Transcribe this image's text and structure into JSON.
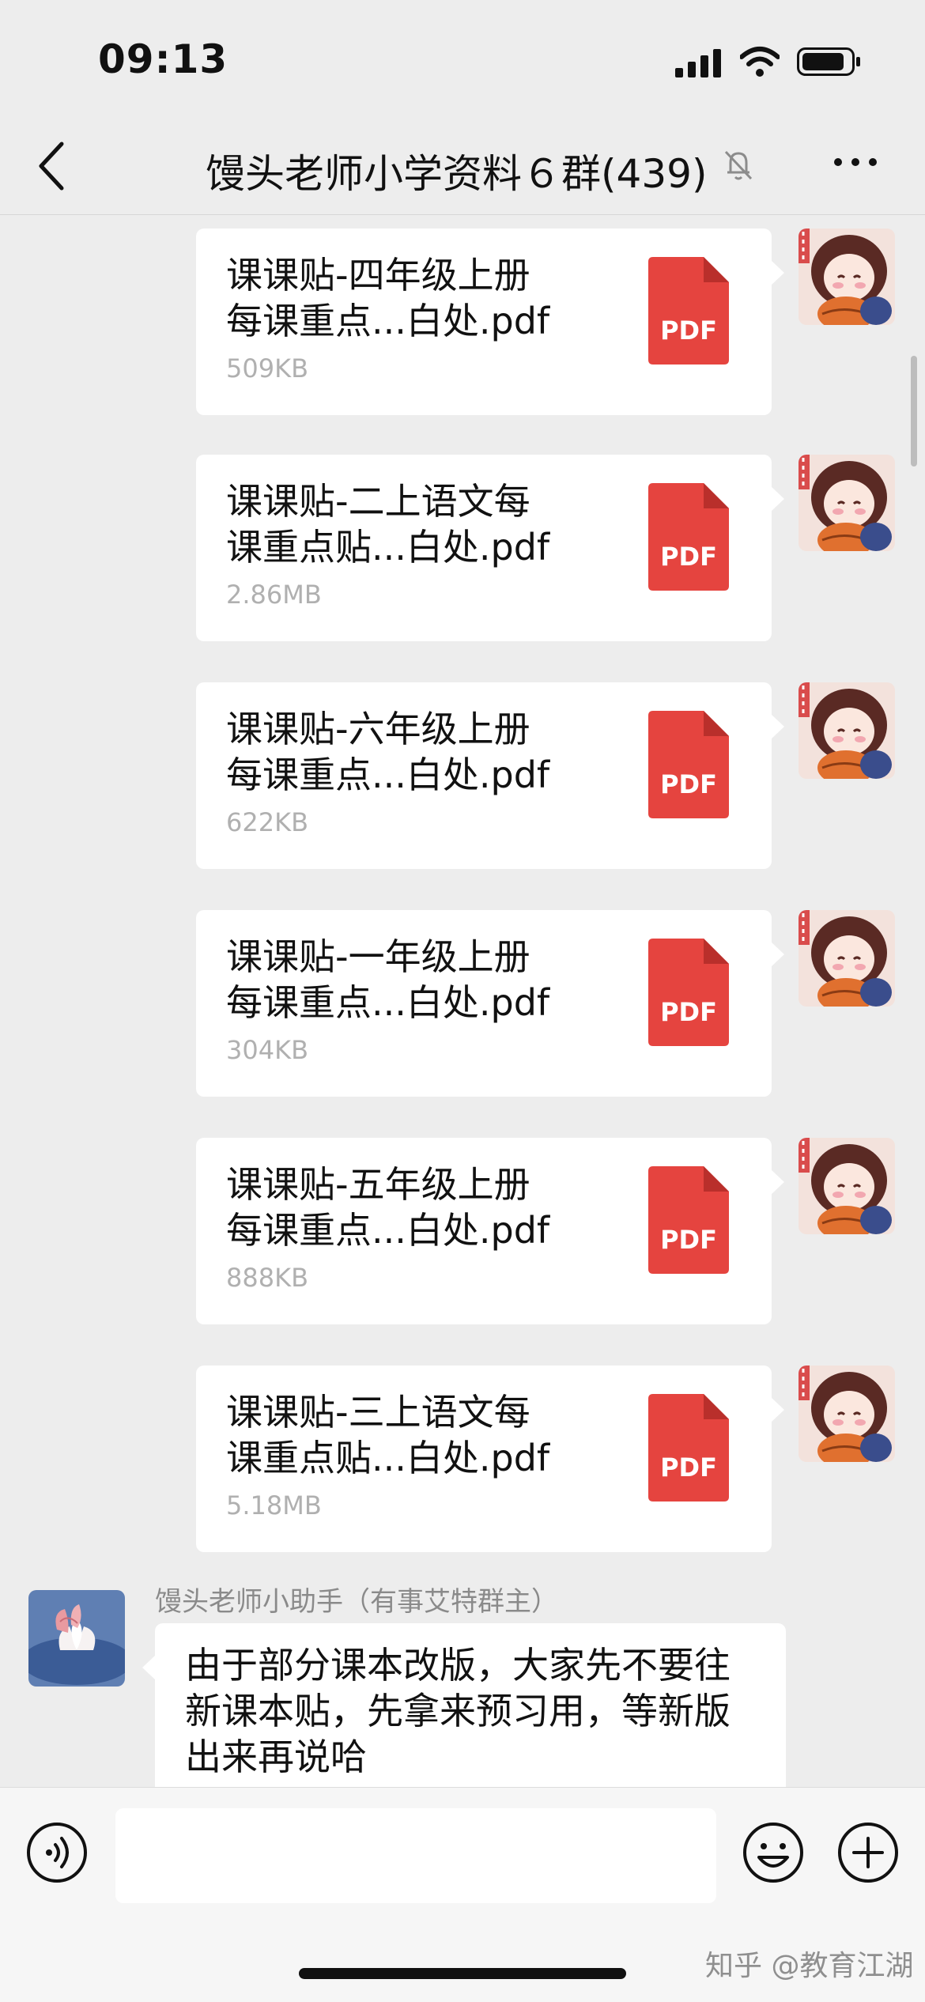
{
  "status_bar": {
    "time": "09:13"
  },
  "nav": {
    "title": "馒头老师小学资料６群(439)",
    "back_icon": "chevron-left-icon",
    "mute_icon": "bell-slash-icon",
    "more_icon": "more-dots-icon"
  },
  "colors": {
    "background": "#ededed",
    "bubble": "#ffffff",
    "pdf_red": "#e5443f",
    "size_gray": "#b0b0b0"
  },
  "messages": [
    {
      "file_name": "课课贴-四年级上册\n每课重点...白处.pdf",
      "size": "509KB",
      "type_label": "PDF"
    },
    {
      "file_name": "课课贴-二上语文每\n课重点贴...白处.pdf",
      "size": "2.86MB",
      "type_label": "PDF"
    },
    {
      "file_name": "课课贴-六年级上册\n每课重点...白处.pdf",
      "size": "622KB",
      "type_label": "PDF"
    },
    {
      "file_name": "课课贴-一年级上册\n每课重点...白处.pdf",
      "size": "304KB",
      "type_label": "PDF"
    },
    {
      "file_name": "课课贴-五年级上册\n每课重点...白处.pdf",
      "size": "888KB",
      "type_label": "PDF"
    },
    {
      "file_name": "课课贴-三上语文每\n课重点贴...白处.pdf",
      "size": "5.18MB",
      "type_label": "PDF"
    }
  ],
  "incoming": {
    "sender": "馒头老师小助手（有事艾特群主）",
    "text": "由于部分课本改版，大家先不要往新课本贴，先拿来预习用，等新版出来再说哈"
  },
  "input_bar": {
    "voice_icon": "voice-icon",
    "emoji_icon": "emoji-icon",
    "plus_icon": "plus-circle-icon"
  },
  "watermark": "知乎 @教育江湖"
}
